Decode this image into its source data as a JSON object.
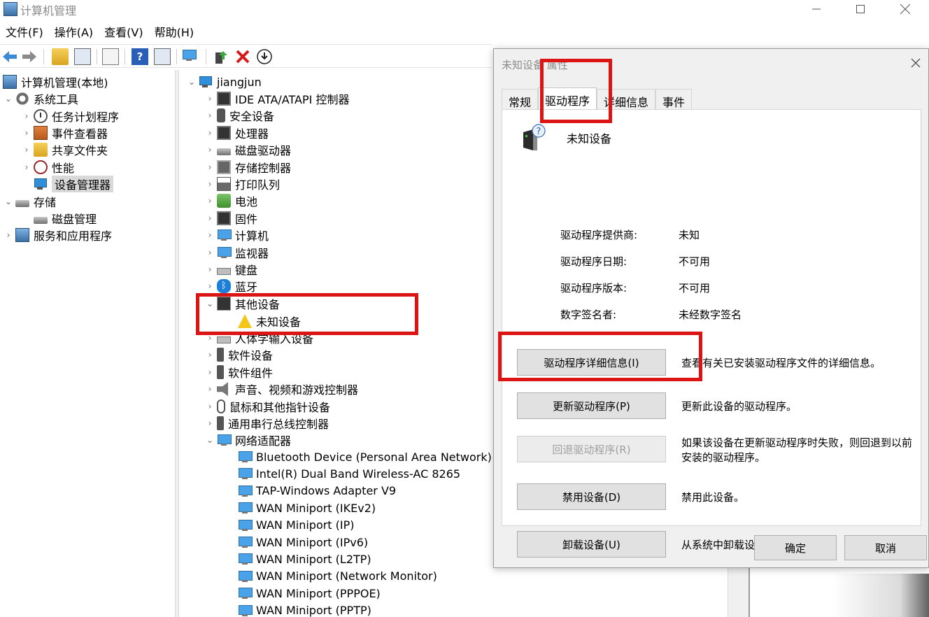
{
  "window": {
    "title": "计算机管理",
    "menu": [
      "文件(F)",
      "操作(A)",
      "查看(V)",
      "帮助(H)"
    ]
  },
  "left_tree": {
    "root": "计算机管理(本地)",
    "system_tools": "系统工具",
    "task_scheduler": "任务计划程序",
    "event_viewer": "事件查看器",
    "shared_folders": "共享文件夹",
    "performance": "性能",
    "device_manager": "设备管理器",
    "storage": "存储",
    "disk_management": "磁盘管理",
    "services_apps": "服务和应用程序"
  },
  "device_tree": {
    "computer": "jiangjun",
    "categories": [
      {
        "label": "IDE ATA/ATAPI 控制器",
        "icon": "ide-controller-icon",
        "cls": "ic-chip"
      },
      {
        "label": "安全设备",
        "icon": "security-device-icon",
        "cls": "ic-key"
      },
      {
        "label": "处理器",
        "icon": "processor-icon",
        "cls": "ic-chip"
      },
      {
        "label": "磁盘驱动器",
        "icon": "disk-drive-icon",
        "cls": "ic-disk"
      },
      {
        "label": "存储控制器",
        "icon": "storage-controller-icon",
        "cls": "ic-store"
      },
      {
        "label": "打印队列",
        "icon": "printer-icon",
        "cls": "ic-printer"
      },
      {
        "label": "电池",
        "icon": "battery-icon",
        "cls": "ic-battery"
      },
      {
        "label": "固件",
        "icon": "firmware-icon",
        "cls": "ic-chip"
      },
      {
        "label": "计算机",
        "icon": "computer-icon",
        "cls": "ic-mon"
      },
      {
        "label": "监视器",
        "icon": "monitor-icon",
        "cls": "ic-mon"
      },
      {
        "label": "键盘",
        "icon": "keyboard-icon",
        "cls": "ic-kbd"
      },
      {
        "label": "蓝牙",
        "icon": "bluetooth-icon",
        "cls": "ic-bt"
      }
    ],
    "other_devices": "其他设备",
    "unknown_device": "未知设备",
    "categories_after": [
      {
        "label": "人体学输入设备",
        "icon": "hid-icon",
        "cls": "ic-kbd"
      },
      {
        "label": "软件设备",
        "icon": "software-device-icon",
        "cls": "ic-usb"
      },
      {
        "label": "软件组件",
        "icon": "software-component-icon",
        "cls": "ic-usb"
      },
      {
        "label": "声音、视频和游戏控制器",
        "icon": "speaker-icon",
        "cls": "ic-speaker"
      },
      {
        "label": "鼠标和其他指针设备",
        "icon": "mouse-icon",
        "cls": "ic-mouse"
      },
      {
        "label": "通用串行总线控制器",
        "icon": "usb-icon",
        "cls": "ic-usb"
      }
    ],
    "network_adapters": "网络适配器",
    "adapters": [
      "Bluetooth Device (Personal Area Network)",
      "Intel(R) Dual Band Wireless-AC 8265",
      "TAP-Windows Adapter V9",
      "WAN Miniport (IKEv2)",
      "WAN Miniport (IP)",
      "WAN Miniport (IPv6)",
      "WAN Miniport (L2TP)",
      "WAN Miniport (Network Monitor)",
      "WAN Miniport (PPPOE)",
      "WAN Miniport (PPTP)"
    ]
  },
  "dialog": {
    "title": "未知设备 属性",
    "tabs": [
      "常规",
      "驱动程序",
      "详细信息",
      "事件"
    ],
    "device_name": "未知设备",
    "props": [
      {
        "label": "驱动程序提供商:",
        "value": "未知"
      },
      {
        "label": "驱动程序日期:",
        "value": "不可用"
      },
      {
        "label": "驱动程序版本:",
        "value": "不可用"
      },
      {
        "label": "数字签名者:",
        "value": "未经数字签名"
      }
    ],
    "buttons": {
      "details": "驱动程序详细信息(I)",
      "details_desc": "查看有关已安装驱动程序文件的详细信息。",
      "update": "更新驱动程序(P)",
      "update_desc": "更新此设备的驱动程序。",
      "rollback": "回退驱动程序(R)",
      "rollback_desc": "如果该设备在更新驱动程序时失败，则回退到以前安装的驱动程序。",
      "disable": "禁用设备(D)",
      "disable_desc": "禁用此设备。",
      "uninstall": "卸载设备(U)",
      "uninstall_desc": "从系统中卸载设备(高级)。"
    },
    "ok": "确定",
    "cancel": "取消"
  },
  "colors": {
    "annotation": "#dc1414",
    "selection": "#d9d9d9"
  }
}
